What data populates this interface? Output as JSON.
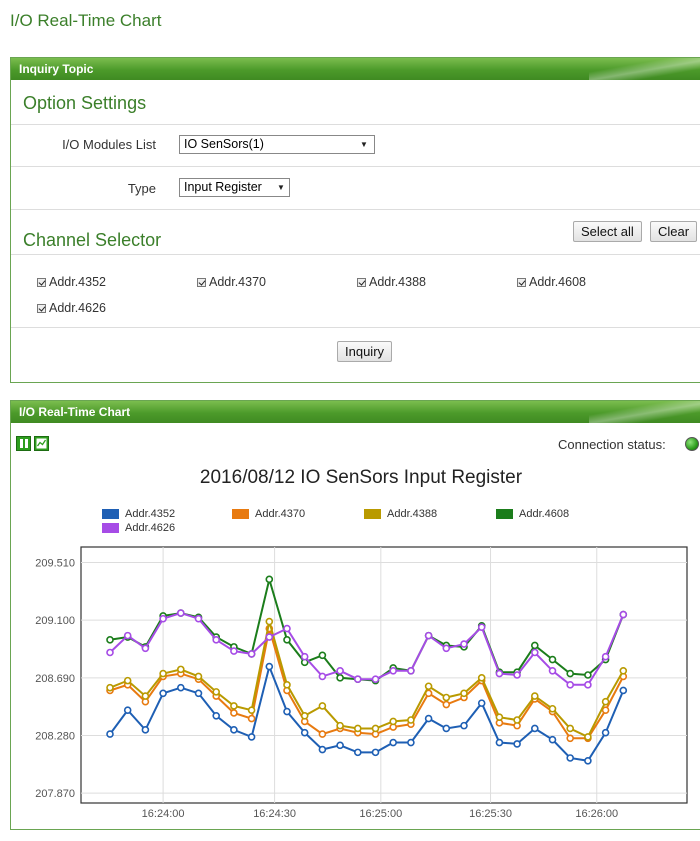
{
  "page_title": "I/O Real-Time Chart",
  "inquiry_panel": {
    "header": "Inquiry Topic",
    "option_settings_title": "Option Settings",
    "modules_label": "I/O Modules List",
    "modules_value": "IO SenSors(1)",
    "type_label": "Type",
    "type_value": "Input Register",
    "channel_selector_title": "Channel Selector",
    "select_all": "Select all",
    "clear": "Clear",
    "channels": [
      {
        "label": "Addr.4352",
        "checked": true
      },
      {
        "label": "Addr.4370",
        "checked": true
      },
      {
        "label": "Addr.4388",
        "checked": true
      },
      {
        "label": "Addr.4608",
        "checked": true
      },
      {
        "label": "Addr.4626",
        "checked": true
      }
    ],
    "inquiry_button": "Inquiry"
  },
  "chart_panel": {
    "header": "I/O Real-Time Chart",
    "connection_label": "Connection status:",
    "connection_color": "#2e9e1e",
    "icons": [
      "pause-icon",
      "chart-icon"
    ]
  },
  "chart_data": {
    "type": "line",
    "title": "2016/08/12 IO SenSors Input Register",
    "xlabel": "",
    "ylabel": "",
    "x_ticks": [
      "16:24:00",
      "16:24:30",
      "16:25:00",
      "16:25:30",
      "16:26:00"
    ],
    "y_ticks": [
      "209.510",
      "209.100",
      "208.690",
      "208.280",
      "207.870"
    ],
    "ylim": [
      207.8,
      209.62
    ],
    "grid": true,
    "legend_position": "top",
    "series": [
      {
        "name": "Addr.4352",
        "color": "#1e5fb4",
        "values": [
          208.29,
          208.46,
          208.32,
          208.58,
          208.62,
          208.58,
          208.42,
          208.32,
          208.27,
          208.77,
          208.45,
          208.3,
          208.18,
          208.21,
          208.16,
          208.16,
          208.23,
          208.23,
          208.4,
          208.33,
          208.35,
          208.51,
          208.23,
          208.22,
          208.33,
          208.25,
          208.12,
          208.1,
          208.3,
          208.6
        ]
      },
      {
        "name": "Addr.4370",
        "color": "#e87a10",
        "values": [
          208.6,
          208.64,
          208.52,
          208.7,
          208.72,
          208.68,
          208.56,
          208.44,
          208.4,
          209.04,
          208.6,
          208.38,
          208.29,
          208.33,
          208.3,
          208.29,
          208.34,
          208.36,
          208.58,
          208.5,
          208.55,
          208.67,
          208.37,
          208.35,
          208.54,
          208.45,
          208.26,
          208.26,
          208.46,
          208.7
        ]
      },
      {
        "name": "Addr.4388",
        "color": "#b99a00",
        "values": [
          208.62,
          208.67,
          208.56,
          208.72,
          208.75,
          208.7,
          208.59,
          208.49,
          208.46,
          209.09,
          208.64,
          208.42,
          208.49,
          208.35,
          208.33,
          208.33,
          208.38,
          208.39,
          208.63,
          208.55,
          208.58,
          208.69,
          208.41,
          208.39,
          208.56,
          208.47,
          208.33,
          208.27,
          208.52,
          208.74
        ]
      },
      {
        "name": "Addr.4608",
        "color": "#1b7d1b",
        "values": [
          208.96,
          208.98,
          208.91,
          209.13,
          209.15,
          209.12,
          208.98,
          208.91,
          208.86,
          209.39,
          208.96,
          208.8,
          208.85,
          208.69,
          208.68,
          208.67,
          208.76,
          208.74,
          208.99,
          208.92,
          208.91,
          209.06,
          208.73,
          208.73,
          208.92,
          208.82,
          208.72,
          208.71,
          208.82,
          209.14
        ]
      },
      {
        "name": "Addr.4626",
        "color": "#a64ce6",
        "values": [
          208.87,
          208.99,
          208.9,
          209.11,
          209.15,
          209.11,
          208.96,
          208.88,
          208.86,
          208.98,
          209.04,
          208.84,
          208.7,
          208.74,
          208.68,
          208.68,
          208.74,
          208.74,
          208.99,
          208.9,
          208.93,
          209.05,
          208.72,
          208.71,
          208.87,
          208.74,
          208.64,
          208.64,
          208.84,
          209.14
        ]
      }
    ]
  }
}
